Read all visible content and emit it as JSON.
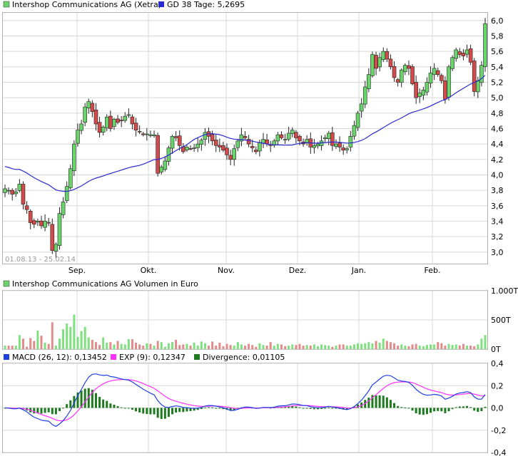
{
  "colors": {
    "up": "#6bd36b",
    "down": "#d24a4a",
    "grid": "#d8d8d8",
    "frame": "#b0b0b0",
    "ma": "#2a2ad0",
    "macd": "#1f3fe0",
    "exp": "#ff30ff",
    "div": "#1e7a1e",
    "volUp": "#7ee07e",
    "volDown": "#e38a8a"
  },
  "chart_data": [
    {
      "type": "candlestick",
      "legend": [
        {
          "label": "Intershop Communications AG (Xetra)",
          "color": "#6bd36b"
        },
        {
          "label": "GD 38 Tage: 5,2695",
          "color": "#2a2ad0"
        }
      ],
      "date_range": "01.08.13 - 25.02.14",
      "x_labels": [
        "Sep.",
        "Okt.",
        "Nov.",
        "Dez.",
        "Jan.",
        "Feb."
      ],
      "y_ticks": [
        "6,0",
        "5,8",
        "5,6",
        "5,4",
        "5,2",
        "5,0",
        "4,8",
        "4,6",
        "4,4",
        "4,2",
        "4,0",
        "3,8",
        "3,6",
        "3,4",
        "3,2",
        "3,0"
      ],
      "ylim": [
        2.85,
        6.1
      ],
      "grid": true,
      "candles_close": [
        3.82,
        3.8,
        3.75,
        3.78,
        3.88,
        3.62,
        3.55,
        3.38,
        3.36,
        3.4,
        3.34,
        3.4,
        3.38,
        3.02,
        3.1,
        3.5,
        3.65,
        3.85,
        4.08,
        4.4,
        4.58,
        4.66,
        4.88,
        4.95,
        4.82,
        4.66,
        4.55,
        4.62,
        4.75,
        4.6,
        4.72,
        4.68,
        4.7,
        4.76,
        4.78,
        4.66,
        4.58,
        4.56,
        4.52,
        4.53,
        4.52,
        4.52,
        4.02,
        4.1,
        4.18,
        4.35,
        4.5,
        4.48,
        4.38,
        4.3,
        4.36,
        4.34,
        4.35,
        4.4,
        4.45,
        4.55,
        4.5,
        4.44,
        4.38,
        4.36,
        4.32,
        4.26,
        4.2,
        4.34,
        4.44,
        4.52,
        4.48,
        4.4,
        4.35,
        4.3,
        4.42,
        4.46,
        4.4,
        4.38,
        4.44,
        4.52,
        4.48,
        4.46,
        4.54,
        4.58,
        4.48,
        4.44,
        4.4,
        4.46,
        4.36,
        4.38,
        4.4,
        4.44,
        4.48,
        4.54,
        4.38,
        4.4,
        4.36,
        4.32,
        4.34,
        4.5,
        4.64,
        4.8,
        4.92,
        5.14,
        5.3,
        5.56,
        5.38,
        5.52,
        5.6,
        5.5,
        5.4,
        5.26,
        5.2,
        5.36,
        5.42,
        5.38,
        5.18,
        5.0,
        5.06,
        5.1,
        5.2,
        5.32,
        5.38,
        5.3,
        5.22,
        4.98,
        5.4,
        5.52,
        5.62,
        5.56,
        5.54,
        5.62,
        5.46,
        5.08,
        5.22,
        5.42,
        5.96
      ],
      "ma_end_value": 5.2695
    },
    {
      "type": "bar",
      "legend": [
        {
          "label": "Intershop Communications AG Volumen in Euro",
          "color": "#6bd36b"
        }
      ],
      "y_ticks": [
        "1.000T",
        "500T",
        "0T"
      ],
      "ylim": [
        0,
        1000
      ],
      "unit": "T",
      "values": [
        60,
        60,
        60,
        60,
        240,
        180,
        40,
        190,
        140,
        320,
        230,
        110,
        90,
        460,
        60,
        180,
        340,
        440,
        380,
        590,
        210,
        310,
        380,
        200,
        160,
        120,
        70,
        200,
        110,
        120,
        80,
        140,
        90,
        80,
        170,
        170,
        110,
        80,
        60,
        100,
        90,
        60,
        140,
        120,
        40,
        100,
        120,
        160,
        70,
        80,
        90,
        60,
        110,
        60,
        130,
        100,
        60,
        130,
        60,
        110,
        50,
        90,
        70,
        60,
        120,
        80,
        60,
        90,
        70,
        40,
        100,
        70,
        60,
        120,
        60,
        90,
        80,
        50,
        60,
        80,
        70,
        90,
        60,
        70,
        60,
        80,
        50,
        80,
        70,
        60,
        40,
        60,
        80,
        80,
        60,
        60,
        80,
        100,
        90,
        100,
        120,
        100,
        140,
        110,
        180,
        140,
        120,
        100,
        60,
        80,
        60,
        50,
        80,
        90,
        60,
        50,
        70,
        80,
        80,
        120,
        100,
        60,
        90,
        70,
        80,
        60,
        90,
        60,
        60,
        50,
        80,
        180,
        240
      ]
    },
    {
      "type": "line",
      "legend": [
        {
          "label": "MACD (26, 12): 0,13452",
          "color": "#1f3fe0"
        },
        {
          "label": "EXP (9): 0,12347",
          "color": "#ff30ff"
        },
        {
          "label": "Divergence: 0,01105",
          "color": "#1e7a1e"
        }
      ],
      "y_ticks": [
        "0,4",
        "0,2",
        "0,0",
        "-0,2",
        "-0,4"
      ],
      "ylim": [
        -0.4,
        0.4
      ],
      "macd_last": 0.13452,
      "exp_last": 0.12347,
      "divergence_last": 0.01105
    }
  ]
}
